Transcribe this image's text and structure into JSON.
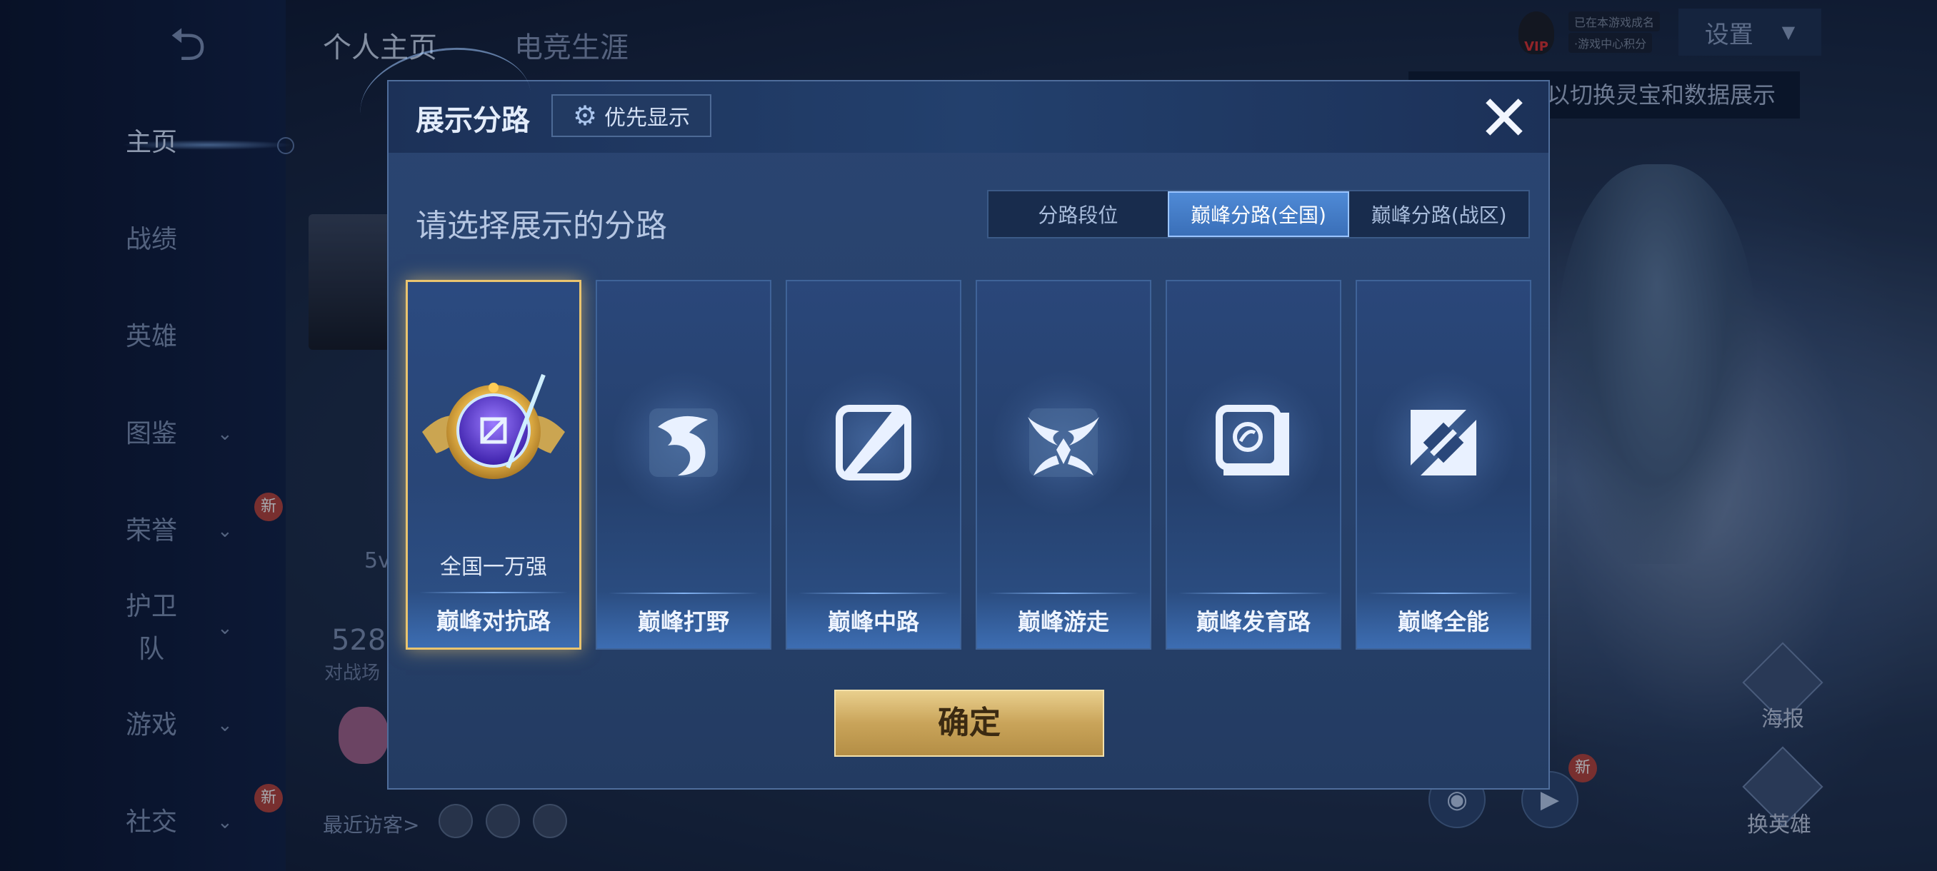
{
  "background": {
    "top_tabs": [
      "个人主页",
      "电竞生涯"
    ],
    "sidebar": [
      {
        "label": "主页",
        "active": true,
        "chevron": false,
        "new": false
      },
      {
        "label": "战绩",
        "active": false,
        "chevron": false,
        "new": false
      },
      {
        "label": "英雄",
        "active": false,
        "chevron": false,
        "new": false
      },
      {
        "label": "图鉴",
        "active": false,
        "chevron": true,
        "new": false
      },
      {
        "label": "荣誉",
        "active": false,
        "chevron": true,
        "new": true
      },
      {
        "label": "护卫队",
        "active": false,
        "chevron": true,
        "new": false
      },
      {
        "label": "游戏",
        "active": false,
        "chevron": true,
        "new": false
      },
      {
        "label": "社交",
        "active": false,
        "chevron": true,
        "new": true
      }
    ],
    "new_badge": "新",
    "settings_label": "设置",
    "vip_label": "VIP",
    "tooltip_text": "以切换灵宝和数据展示",
    "stat_value": "528",
    "stat_label": "对战场",
    "visitors_label": "最近访客>",
    "right_labels": {
      "poster": "海报",
      "change_hero": "换英雄"
    },
    "small_tag_1": "已在本游戏成名",
    "small_tag_2": "·游戏中心积分",
    "partial_text_5v": "5v"
  },
  "modal": {
    "title": "展示分路",
    "priority_label": "优先显示",
    "close_icon": "close-icon",
    "subtitle": "请选择展示的分路",
    "segments": [
      {
        "label": "分路段位",
        "active": false
      },
      {
        "label": "巅峰分路(全国)",
        "active": true
      },
      {
        "label": "巅峰分路(战区)",
        "active": false
      }
    ],
    "cards": [
      {
        "name": "巅峰对抗路",
        "rank": "全国一万强",
        "selected": true,
        "icon": "golden-rank-badge-icon"
      },
      {
        "name": "巅峰打野",
        "rank": "",
        "selected": false,
        "icon": "jungle-dragon-icon"
      },
      {
        "name": "巅峰中路",
        "rank": "",
        "selected": false,
        "icon": "mid-lane-icon"
      },
      {
        "name": "巅峰游走",
        "rank": "",
        "selected": false,
        "icon": "roam-wings-icon"
      },
      {
        "name": "巅峰发育路",
        "rank": "",
        "selected": false,
        "icon": "farm-lane-icon"
      },
      {
        "name": "巅峰全能",
        "rank": "",
        "selected": false,
        "icon": "all-round-icon"
      }
    ],
    "confirm_label": "确定"
  },
  "colors": {
    "accent_gold": "#e9c46f",
    "segment_active": "#4f8ad6"
  }
}
